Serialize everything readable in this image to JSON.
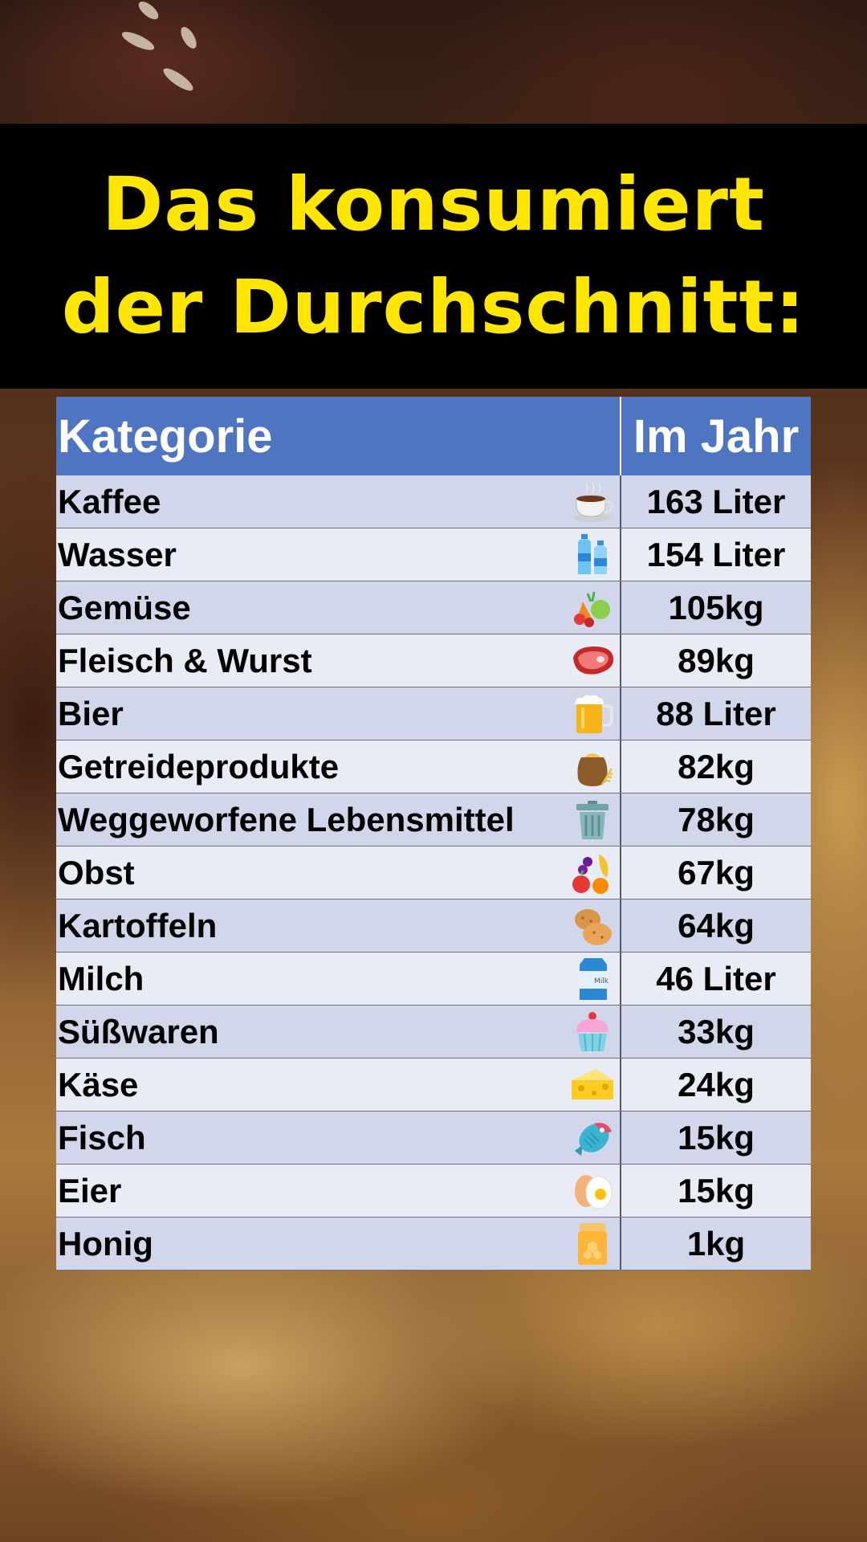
{
  "title": {
    "line1": "Das konsumiert",
    "line2": "der Durchschnitt:"
  },
  "colors": {
    "title_text": "#ffe600",
    "title_band": "#000000",
    "header_bg": "#4f74c2",
    "row_odd": "#d1d6ea",
    "row_even": "#e9ebf5"
  },
  "table": {
    "headers": [
      "Kategorie",
      "Im Jahr"
    ],
    "rows": [
      {
        "label": "Kaffee",
        "value": "163 Liter",
        "icon": "coffee-cup-icon"
      },
      {
        "label": "Wasser",
        "value": "154 Liter",
        "icon": "water-bottles-icon"
      },
      {
        "label": "Gemüse",
        "value": "105kg",
        "icon": "vegetables-icon"
      },
      {
        "label": "Fleisch & Wurst",
        "value": "89kg",
        "icon": "steak-icon"
      },
      {
        "label": "Bier",
        "value": "88 Liter",
        "icon": "beer-mug-icon"
      },
      {
        "label": "Getreideprodukte",
        "value": "82kg",
        "icon": "grain-sack-icon"
      },
      {
        "label": "Weggeworfene Lebensmittel",
        "value": "78kg",
        "icon": "trash-can-icon"
      },
      {
        "label": "Obst",
        "value": "67kg",
        "icon": "fruit-icon"
      },
      {
        "label": "Kartoffeln",
        "value": "64kg",
        "icon": "potatoes-icon"
      },
      {
        "label": "Milch",
        "value": "46 Liter",
        "icon": "milk-carton-icon"
      },
      {
        "label": "Süßwaren",
        "value": "33kg",
        "icon": "cupcake-icon"
      },
      {
        "label": "Käse",
        "value": "24kg",
        "icon": "cheese-icon"
      },
      {
        "label": "Fisch",
        "value": "15kg",
        "icon": "fish-icon"
      },
      {
        "label": "Eier",
        "value": "15kg",
        "icon": "egg-icon"
      },
      {
        "label": "Honig",
        "value": "1kg",
        "icon": "honey-jar-icon"
      }
    ],
    "milk_icon_text": "Milk"
  }
}
